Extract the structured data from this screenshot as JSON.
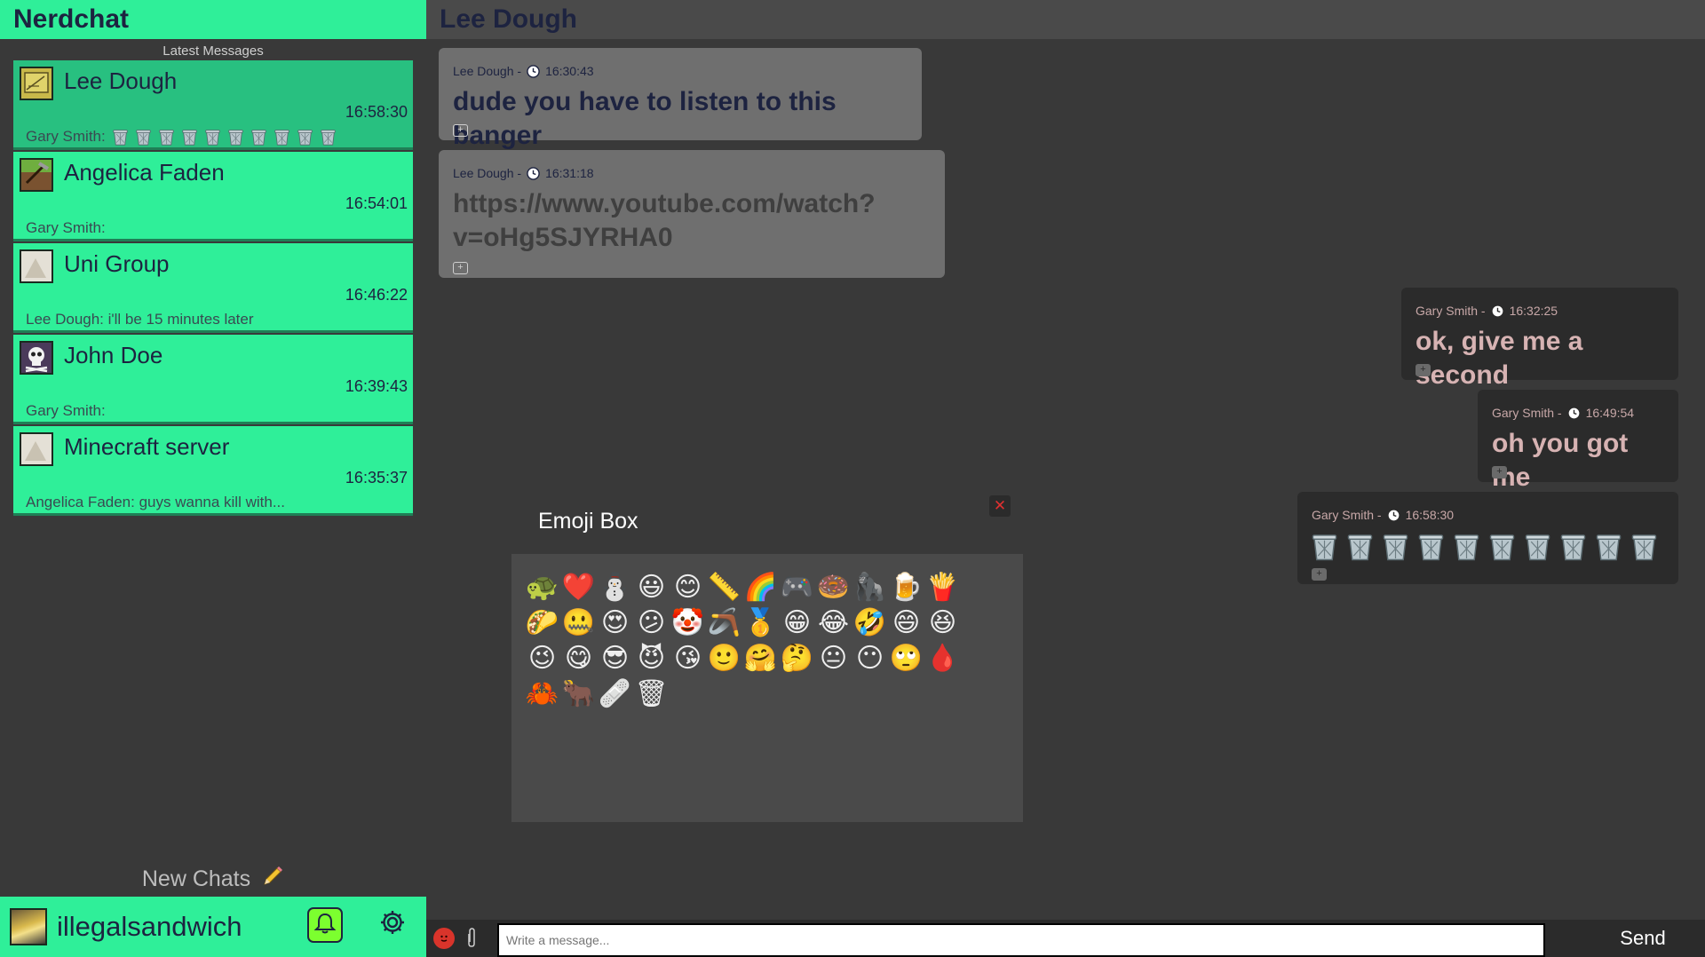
{
  "app": {
    "title": "Nerdchat"
  },
  "sidebar": {
    "latest_label": "Latest Messages",
    "chats": [
      {
        "name": "Lee Dough",
        "time": "16:58:30",
        "preview_prefix": "Gary Smith:",
        "preview_text": "",
        "trash_count": 10,
        "avatar": "yellow-art-avatar"
      },
      {
        "name": "Angelica Faden",
        "time": "16:54:01",
        "preview_prefix": "Gary Smith:",
        "preview_text": "",
        "avatar": "minecraft-avatar"
      },
      {
        "name": "Uni Group",
        "time": "16:46:22",
        "preview_prefix": "",
        "preview_text": "Lee Dough: i'll be 15 minutes later",
        "avatar": "default-avatar"
      },
      {
        "name": "John Doe",
        "time": "16:39:43",
        "preview_prefix": "Gary Smith:",
        "preview_text": "",
        "avatar": "skull-avatar"
      },
      {
        "name": "Minecraft server",
        "time": "16:35:37",
        "preview_prefix": "",
        "preview_text": "Angelica Faden: guys wanna kill with...",
        "avatar": "default-avatar"
      }
    ],
    "new_chats_label": "New Chats",
    "user": {
      "name": "illegalsandwich"
    }
  },
  "conversation": {
    "title": "Lee Dough",
    "messages": [
      {
        "sender": "Lee Dough -",
        "time": "16:30:43",
        "text": "dude you have to listen to this banger",
        "direction": "incoming"
      },
      {
        "sender": "Lee Dough -",
        "time": "16:31:18",
        "text": "https://www.youtube.com/watch?v=oHg5SJYRHA0",
        "direction": "incoming",
        "is_link": true
      },
      {
        "sender": "Gary Smith -",
        "time": "16:32:25",
        "text": "ok, give me a second",
        "direction": "outgoing"
      },
      {
        "sender": "Gary Smith -",
        "time": "16:49:54",
        "text": "oh you got me",
        "direction": "outgoing"
      },
      {
        "sender": "Gary Smith -",
        "time": "16:58:30",
        "text": "",
        "trash_count": 10,
        "direction": "outgoing"
      }
    ],
    "react_label": "+"
  },
  "emoji_box": {
    "title": "Emoji Box",
    "close_label": "✕",
    "emojis": [
      "🐢",
      "❤️",
      "⛄",
      "😃",
      "😊",
      "📏",
      "🌈",
      "🎮",
      "🍩",
      "🦍",
      "🍺",
      "🍟",
      "🌮",
      "🤐",
      "😍",
      "😕",
      "🤡",
      "🪃",
      "🥇",
      "😁",
      "😂",
      "🤣",
      "😄",
      "😆",
      "😉",
      "😋",
      "😎",
      "😈",
      "😘",
      "🙂",
      "🤗",
      "🤔",
      "😐",
      "😶",
      "🙄",
      "🩸",
      "🦀",
      "🐂",
      "🩹",
      "🗑"
    ]
  },
  "composer": {
    "placeholder": "Write a message...",
    "send_label": "Send",
    "attach_icon": "paperclip-icon",
    "emoji_icon": "devil-icon"
  },
  "colors": {
    "accent": "#2fef99",
    "active_chat": "#28c080",
    "navy_text": "#1d2340",
    "bell": "#7cff2f"
  }
}
